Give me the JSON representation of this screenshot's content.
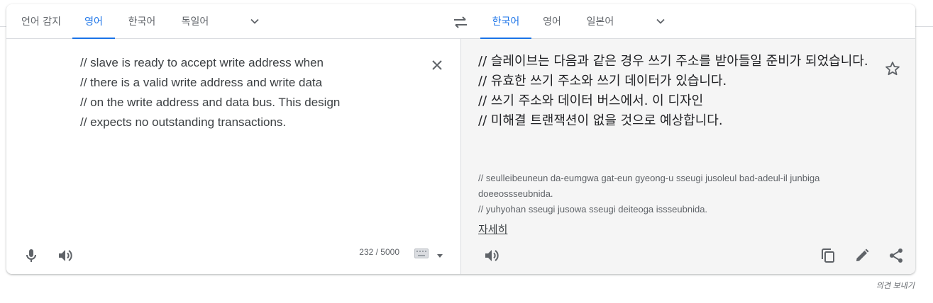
{
  "source_tabs": [
    {
      "label": "언어 감지",
      "active": false
    },
    {
      "label": "영어",
      "active": true
    },
    {
      "label": "한국어",
      "active": false
    },
    {
      "label": "독일어",
      "active": false
    }
  ],
  "target_tabs": [
    {
      "label": "한국어",
      "active": true
    },
    {
      "label": "영어",
      "active": false
    },
    {
      "label": "일본어",
      "active": false
    }
  ],
  "source": {
    "text": "// slave is ready to accept write address when\n// there is a valid write address and write data\n// on the write address and data bus. This design\n// expects no outstanding transactions.",
    "char_count": "232 / 5000"
  },
  "target": {
    "text": "// 슬레이브는 다음과 같은 경우 쓰기 주소를 받아들일 준비가 되었습니다.\n// 유효한 쓰기 주소와 쓰기 데이터가 있습니다.\n// 쓰기 주소와 데이터 버스에서. 이 디자인\n// 미해결 트랜잭션이 없을 것으로 예상합니다.",
    "romanization": "// seulleibeuneun da-eumgwa gat-eun gyeong-u sseugi jusoleul bad-adeul-il junbiga doeeossseubnida.\n// yuhyohan sseugi jusowa sseugi deiteoga issseubnida.",
    "more_label": "자세히"
  },
  "feedback_label": "의견 보내기",
  "icons": {
    "swap": "swap-languages-icon",
    "clear": "close-icon",
    "mic": "microphone-icon",
    "speaker": "speaker-icon",
    "keyboard": "keyboard-icon",
    "star": "star-icon",
    "copy": "copy-icon",
    "edit": "pencil-icon",
    "share": "share-icon"
  },
  "colors": {
    "accent": "#1a73e8",
    "icon": "#5f6368",
    "target_bg": "#f5f5f5"
  }
}
